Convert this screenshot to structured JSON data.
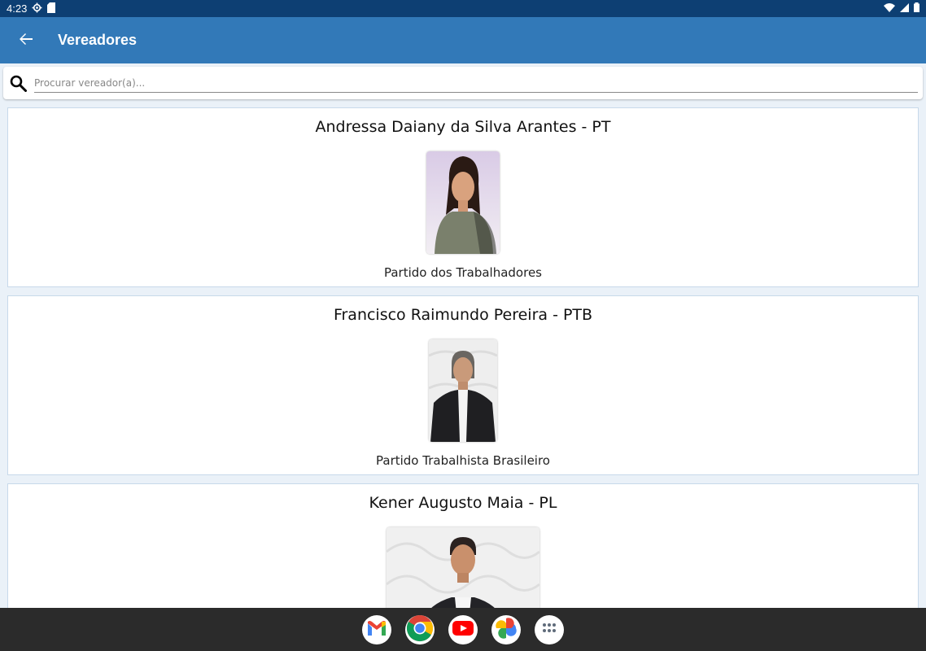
{
  "status_bar": {
    "time": "4:23"
  },
  "app_bar": {
    "title": "Vereadores"
  },
  "search": {
    "placeholder": "Procurar vereador(a)...",
    "value": ""
  },
  "councilors": [
    {
      "name": "Andressa Daiany da Silva Arantes - PT",
      "party": "Partido dos Trabalhadores"
    },
    {
      "name": "Francisco Raimundo Pereira - PTB",
      "party": "Partido Trabalhista Brasileiro"
    },
    {
      "name": "Kener Augusto Maia - PL",
      "party": ""
    }
  ],
  "dock": [
    "gmail-icon",
    "chrome-icon",
    "youtube-icon",
    "photos-icon",
    "app-drawer-icon"
  ]
}
